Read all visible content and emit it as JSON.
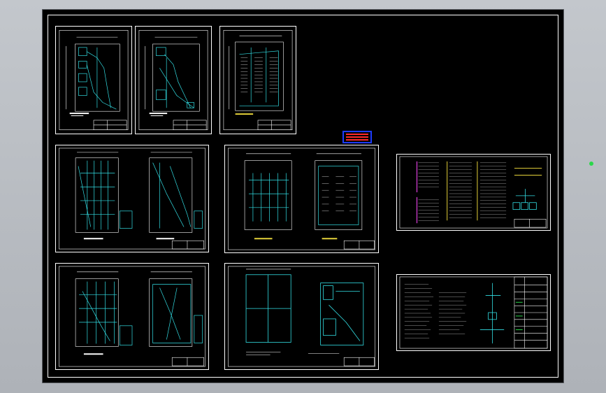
{
  "app": {
    "name": "",
    "colors": {
      "background": "#b8bcc2",
      "canvas": "#000000",
      "frame": "#ffffff",
      "drawing_lines": "#33e0e6",
      "wiring": "#1ce7ef",
      "accent_magenta": "#e040e0",
      "accent_yellow": "#e6d33a",
      "accent_green": "#2bd84a",
      "marker_blue": "#1d3cff",
      "marker_red": "#ff2a2a"
    }
  },
  "canvas": {
    "sheets": [
      {
        "id": "sheet-1",
        "kind": "floor-plan"
      },
      {
        "id": "sheet-2",
        "kind": "floor-plan"
      },
      {
        "id": "sheet-3",
        "kind": "floor-plan-parking"
      },
      {
        "id": "sheet-4",
        "kind": "double-floor-plan"
      },
      {
        "id": "sheet-5",
        "kind": "double-floor-plan-parking"
      },
      {
        "id": "sheet-6",
        "kind": "double-floor-plan"
      },
      {
        "id": "sheet-7",
        "kind": "grid-and-floor-plan"
      },
      {
        "id": "sheet-8",
        "kind": "system-diagram"
      },
      {
        "id": "sheet-9",
        "kind": "notes-and-legend"
      }
    ],
    "grip_icon": "selection-grip-icon",
    "marker_icon": "red-marker-icon"
  }
}
